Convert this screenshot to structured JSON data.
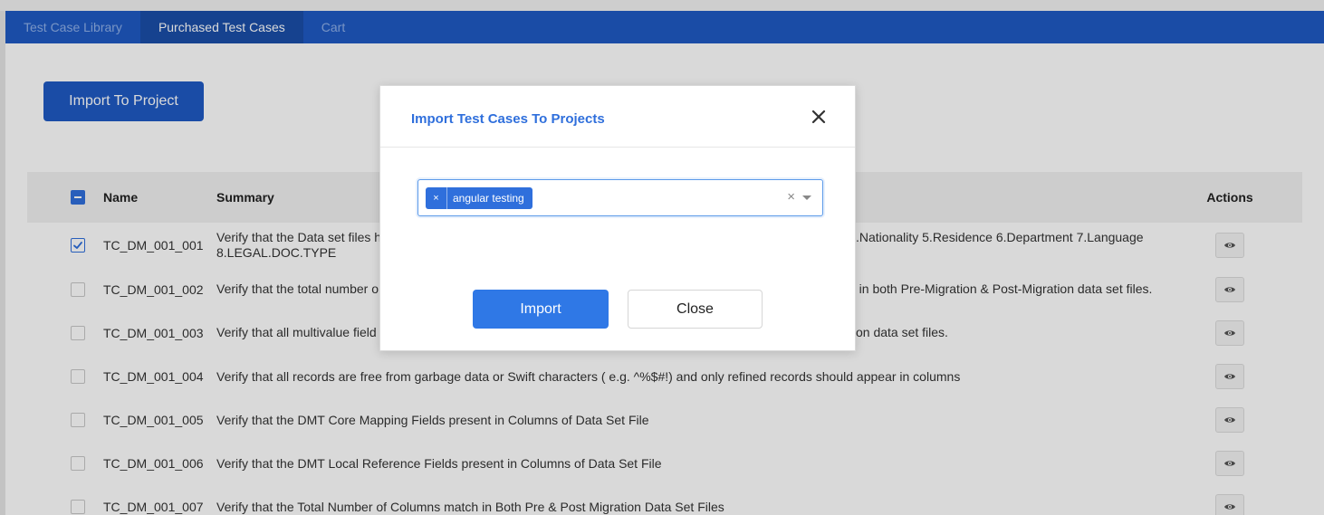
{
  "tabs": [
    {
      "label": "Test Case Library"
    },
    {
      "label": "Purchased Test Cases"
    },
    {
      "label": "Cart"
    }
  ],
  "toolbar": {
    "import_label": "Import To Project"
  },
  "table": {
    "columns": {
      "name": "Name",
      "summary": "Summary",
      "actions": "Actions"
    },
    "rows": [
      {
        "name": "TC_DM_001_001",
        "summary": "Verify that the Data set files h",
        "summary_right": ".Nationality 5.Residence 6.Department 7.Language",
        "summary_line2": "8.LEGAL.DOC.TYPE",
        "checked": true
      },
      {
        "name": "TC_DM_001_002",
        "summary": "Verify that the total number o",
        "summary_right": "d in both Pre-Migration & Post-Migration data set files.",
        "checked": false
      },
      {
        "name": "TC_DM_001_003",
        "summary": "Verify that all multivalue field",
        "summary_right": "on data set files.",
        "checked": false
      },
      {
        "name": "TC_DM_001_004",
        "summary": "Verify that all records are free from garbage data or Swift characters ( e.g. ^%$#!) and only refined records should appear in columns",
        "checked": false
      },
      {
        "name": "TC_DM_001_005",
        "summary": "Verify that the DMT Core Mapping Fields present in Columns of Data Set File",
        "checked": false
      },
      {
        "name": "TC_DM_001_006",
        "summary": "Verify that the DMT Local Reference Fields present in Columns of Data Set File",
        "checked": false
      },
      {
        "name": "TC_DM_001_007",
        "summary": "Verify that the Total Number of Columns match in Both Pre & Post Migration Data Set Files",
        "checked": false
      }
    ]
  },
  "modal": {
    "title": "Import Test Cases To Projects",
    "selected_project": "angular testing",
    "chip_remove": "×",
    "clear": "×",
    "import_label": "Import",
    "close_label": "Close"
  },
  "colors": {
    "brand": "#1f5ac4",
    "accent": "#2f78e6",
    "title": "#2f6fdc"
  }
}
